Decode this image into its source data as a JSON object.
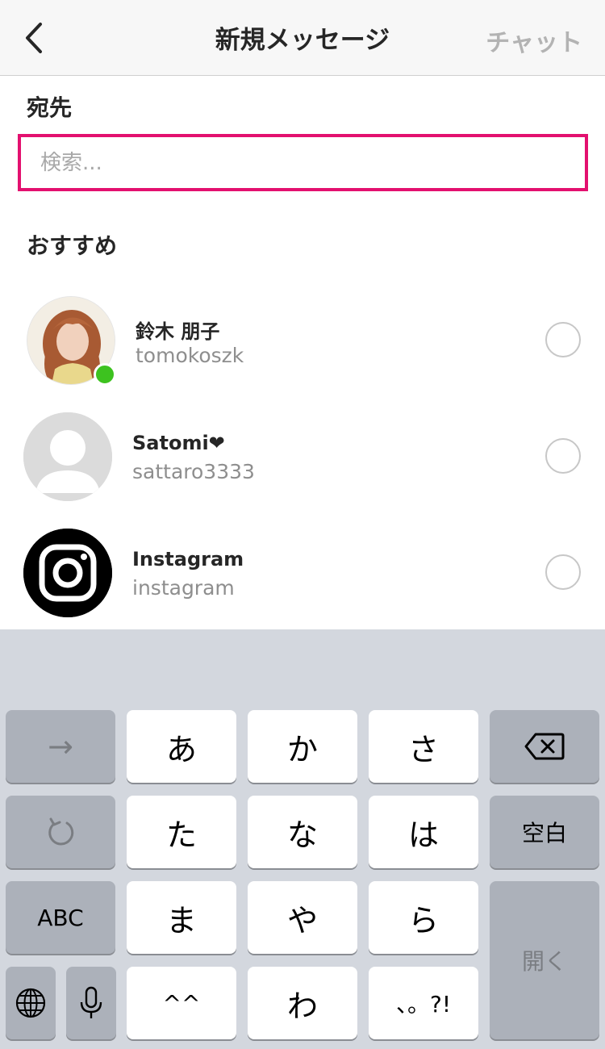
{
  "header": {
    "title": "新規メッセージ",
    "chat_label": "チャット"
  },
  "recipient": {
    "label": "宛先",
    "search_placeholder": "検索..."
  },
  "suggestions": {
    "label": "おすすめ",
    "users": [
      {
        "name": "鈴木 朋子",
        "handle": "tomokoszk",
        "online": true
      },
      {
        "name": "Satomi❤",
        "handle": "sattaro3333",
        "online": false
      },
      {
        "name": "Instagram",
        "handle": "instagram",
        "online": false
      }
    ]
  },
  "keyboard": {
    "row1": [
      "→",
      "あ",
      "か",
      "さ",
      "⌫"
    ],
    "row2": [
      "↺",
      "た",
      "な",
      "は",
      "空白"
    ],
    "row3": [
      "ABC",
      "ま",
      "や",
      "ら",
      "開く"
    ],
    "row4": [
      "🌐",
      "🎤",
      "^^",
      "わ",
      "、。?!"
    ]
  },
  "colors": {
    "search_border": "#e3106f",
    "online": "#3dc21f",
    "keyboard_bg": "#d3d7de"
  }
}
